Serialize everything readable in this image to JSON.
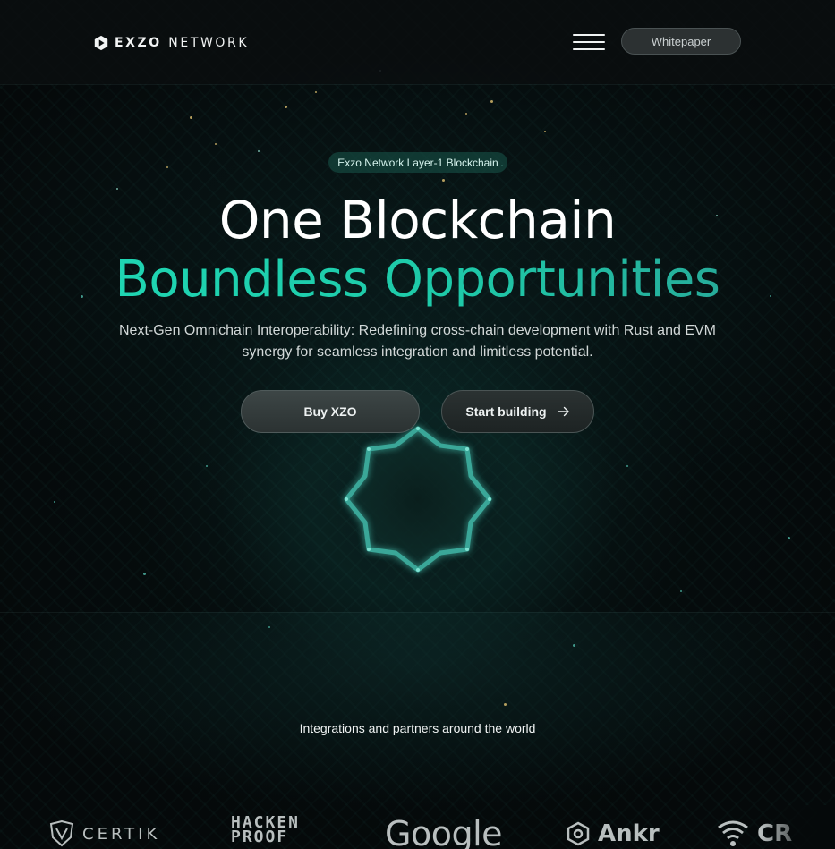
{
  "header": {
    "logo_text_bold": "EXZO",
    "logo_text_light": "NETWORK",
    "menu_icon": "hamburger-icon",
    "whitepaper_label": "Whitepaper"
  },
  "hero": {
    "badge": "Exzo Network Layer-1 Blockchain",
    "title_line_1": "One Blockchain",
    "title_line_2": "Boundless Opportunities",
    "subtitle_line_1": "Next-Gen Omnichain Interoperability: Redefining cross-chain development with Rust and EVM",
    "subtitle_line_2": "synergy for seamless integration and limitless potential.",
    "buy_label": "Buy XZO",
    "build_label": "Start building",
    "build_icon": "arrow-right-icon"
  },
  "partners": {
    "title": "Integrations and partners around the world",
    "items": [
      {
        "name": "CERTIK",
        "icon": "certik-shield-icon"
      },
      {
        "name": "HACKEN",
        "name_line_2": "PROOF",
        "icon": "hackenproof-icon"
      },
      {
        "name": "Google",
        "icon": ""
      },
      {
        "name": "Ankr",
        "icon": "ankr-icon"
      },
      {
        "name": "CR",
        "icon": "wifi-shield-icon"
      }
    ]
  },
  "colors": {
    "accent": "#1fd9b5",
    "background": "#05090a",
    "portal": "#3fb5a5"
  }
}
